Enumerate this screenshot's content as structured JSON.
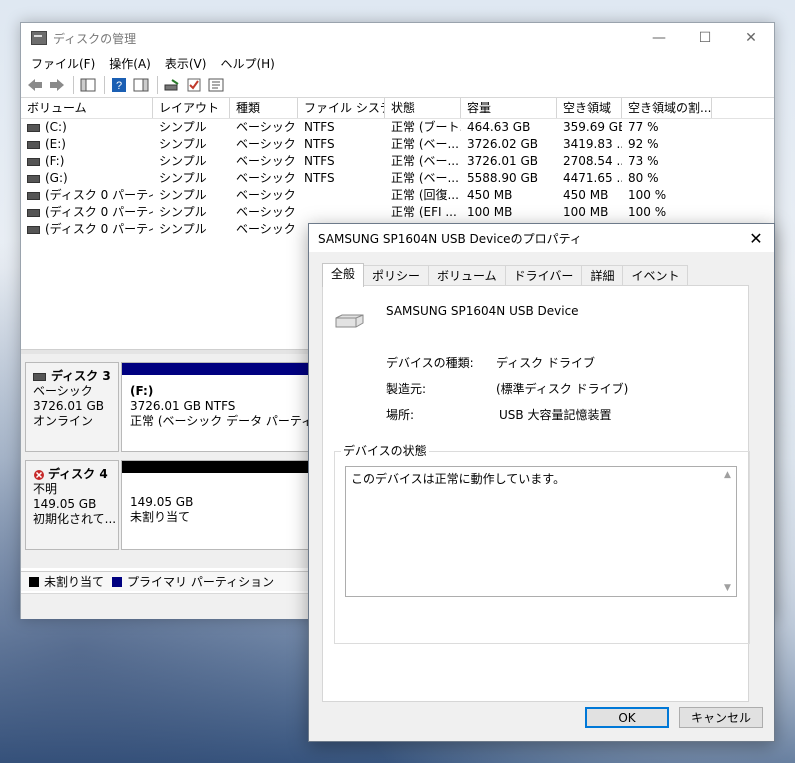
{
  "disk_mgmt": {
    "title": "ディスクの管理",
    "menu": [
      "ファイル(F)",
      "操作(A)",
      "表示(V)",
      "ヘルプ(H)"
    ],
    "columns": [
      "ボリューム",
      "レイアウト",
      "種類",
      "ファイル システム",
      "状態",
      "容量",
      "空き領域",
      "空き領域の割..."
    ],
    "rows": [
      [
        "(C:)",
        "シンプル",
        "ベーシック",
        "NTFS",
        "正常 (ブート...",
        "464.63 GB",
        "359.69 GB",
        "77 %"
      ],
      [
        "(E:)",
        "シンプル",
        "ベーシック",
        "NTFS",
        "正常 (ベー...",
        "3726.02 GB",
        "3419.83 ...",
        "92 %"
      ],
      [
        "(F:)",
        "シンプル",
        "ベーシック",
        "NTFS",
        "正常 (ベー...",
        "3726.01 GB",
        "2708.54 ...",
        "73 %"
      ],
      [
        "(G:)",
        "シンプル",
        "ベーシック",
        "NTFS",
        "正常 (ベー...",
        "5588.90 GB",
        "4471.65 ...",
        "80 %"
      ],
      [
        "(ディスク 0 パーティシ...",
        "シンプル",
        "ベーシック",
        "",
        "正常 (回復...",
        "450 MB",
        "450 MB",
        "100 %"
      ],
      [
        "(ディスク 0 パーティシ...",
        "シンプル",
        "ベーシック",
        "",
        "正常 (EFI ...",
        "100 MB",
        "100 MB",
        "100 %"
      ],
      [
        "(ディスク 0 パーティシ...",
        "シンプル",
        "ベーシック",
        "",
        "",
        "",
        "",
        ""
      ]
    ],
    "disks": [
      {
        "name": "ディスク 3",
        "type": "ベーシック",
        "size": "3726.01 GB",
        "status": "オンライン",
        "part_name": "(F:)",
        "part_size": "3726.01 GB NTFS",
        "part_status": "正常 (ベーシック データ パーティション)"
      },
      {
        "name": "ディスク 4",
        "type": "不明",
        "size": "149.05 GB",
        "status": "初期化されて...",
        "part_size": "149.05 GB",
        "part_status": "未割り当て"
      }
    ],
    "legend": [
      "未割り当て",
      "プライマリ パーティション"
    ],
    "colors": {
      "unallocated": "#000000",
      "primary": "#000080"
    }
  },
  "dialog": {
    "title": "SAMSUNG SP1604N USB Deviceのプロパティ",
    "tabs": [
      "全般",
      "ポリシー",
      "ボリューム",
      "ドライバー",
      "詳細",
      "イベント"
    ],
    "device_name": "SAMSUNG SP1604N USB Device",
    "device_type_label": "デバイスの種類:",
    "device_type": "ディスク ドライブ",
    "manufacturer_label": "製造元:",
    "manufacturer": "(標準ディスク ドライブ)",
    "location_label": "場所:",
    "location": "USB 大容量記憶装置",
    "status_group": "デバイスの状態",
    "status_text": "このデバイスは正常に動作しています。",
    "ok": "OK",
    "cancel": "キャンセル"
  }
}
